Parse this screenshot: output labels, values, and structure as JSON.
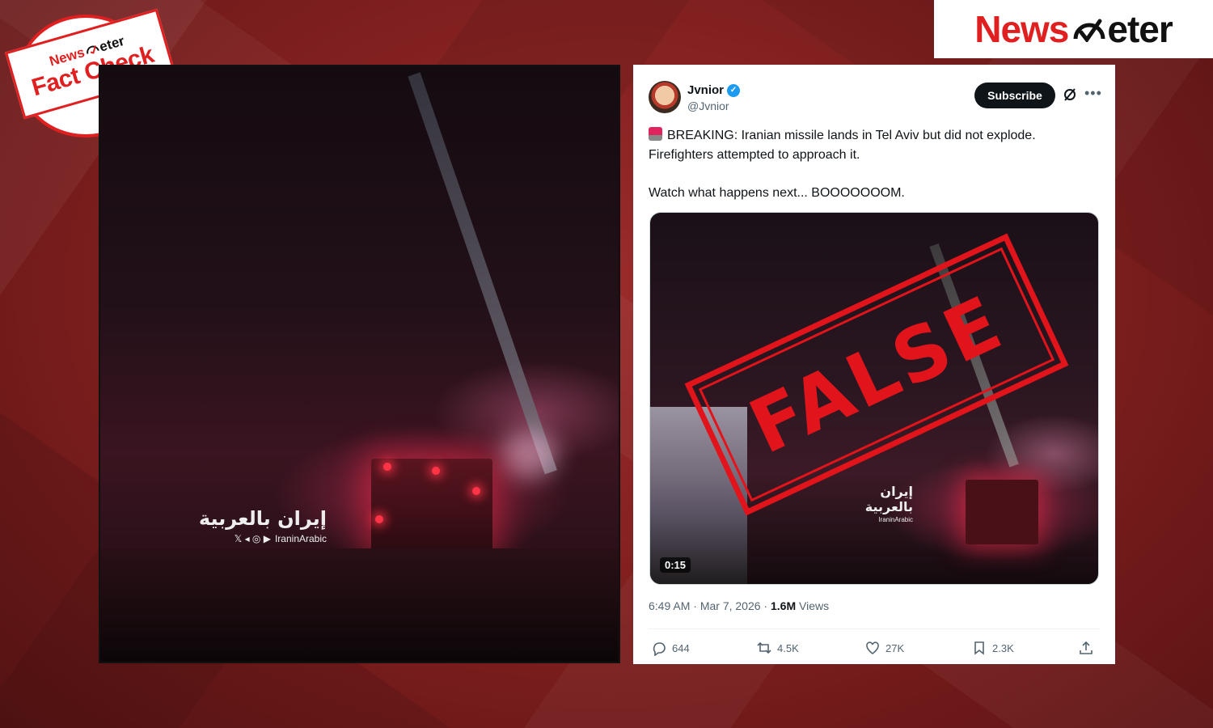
{
  "brand": {
    "left": "News",
    "right": "eter"
  },
  "stamp": {
    "top_left": "News",
    "top_right": "eter",
    "main": "Fact Check"
  },
  "left_video": {
    "watermark_ar": "إيران بالعربية",
    "watermark_handle": "IraninArabic"
  },
  "tweet": {
    "author_name": "Jvnior",
    "author_handle": "@Jvnior",
    "subscribe_label": "Subscribe",
    "text_line1": "BREAKING: Iranian missile lands in Tel Aviv but did not explode. Firefighters attempted to approach it.",
    "text_line2": "Watch what happens next... BOOOOOOOM.",
    "media": {
      "watermark_ar": "إيران بالعربية",
      "watermark_handle": "IraninArabic",
      "duration": "0:15",
      "stamp_text": "FALSE"
    },
    "time": "6:49 AM",
    "date": "Mar 7, 2026",
    "views_count": "1.6M",
    "views_label": "Views",
    "replies": "644",
    "reposts": "4.5K",
    "likes": "27K",
    "bookmarks": "2.3K"
  },
  "colors": {
    "accent_red": "#e02020",
    "verified_blue": "#1d9bf0",
    "background_red": "#7d1e1e"
  },
  "icons": [
    "meter-icon",
    "verified-icon",
    "grok-icon",
    "more-icon",
    "siren-icon",
    "reply-icon",
    "repost-icon",
    "like-icon",
    "bookmark-icon",
    "share-icon"
  ]
}
